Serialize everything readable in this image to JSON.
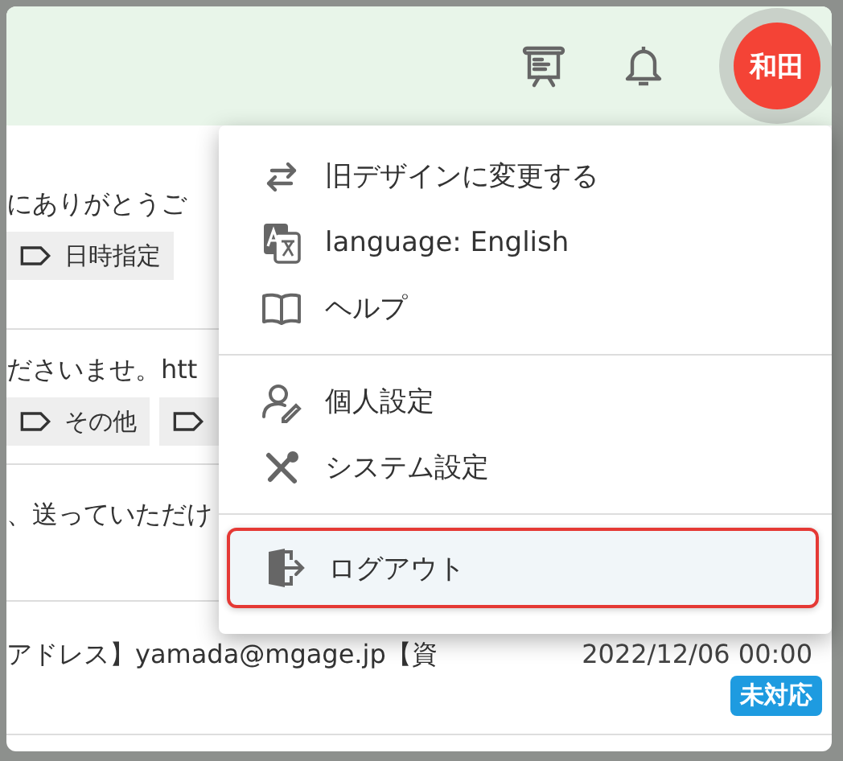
{
  "header": {
    "avatar": {
      "initials": "和田"
    }
  },
  "rows": [
    {
      "text": "にありがとうご",
      "tags": [
        "日時指定"
      ],
      "more_tag": false
    },
    {
      "text": "ださいませ。htt",
      "tags": [
        "その他"
      ],
      "more_tag": true
    },
    {
      "text": "、送っていただけ",
      "tags": [],
      "more_tag": false
    },
    {
      "text": "アドレス】yamada@mgage.jp【資",
      "date": "2022/12/06 00:00",
      "status": "未対応",
      "tags": [],
      "more_tag": false
    }
  ],
  "menu": {
    "groups": [
      [
        {
          "kind": "switch",
          "label": "旧デザインに変更する",
          "selected": false
        },
        {
          "kind": "language",
          "label": "language: English",
          "selected": false
        },
        {
          "kind": "help",
          "label": "ヘルプ",
          "selected": false
        }
      ],
      [
        {
          "kind": "profile",
          "label": "個人設定",
          "selected": false
        },
        {
          "kind": "tools",
          "label": "システム設定",
          "selected": false
        }
      ],
      [
        {
          "kind": "logout",
          "label": "ログアウト",
          "selected": true
        }
      ]
    ]
  }
}
